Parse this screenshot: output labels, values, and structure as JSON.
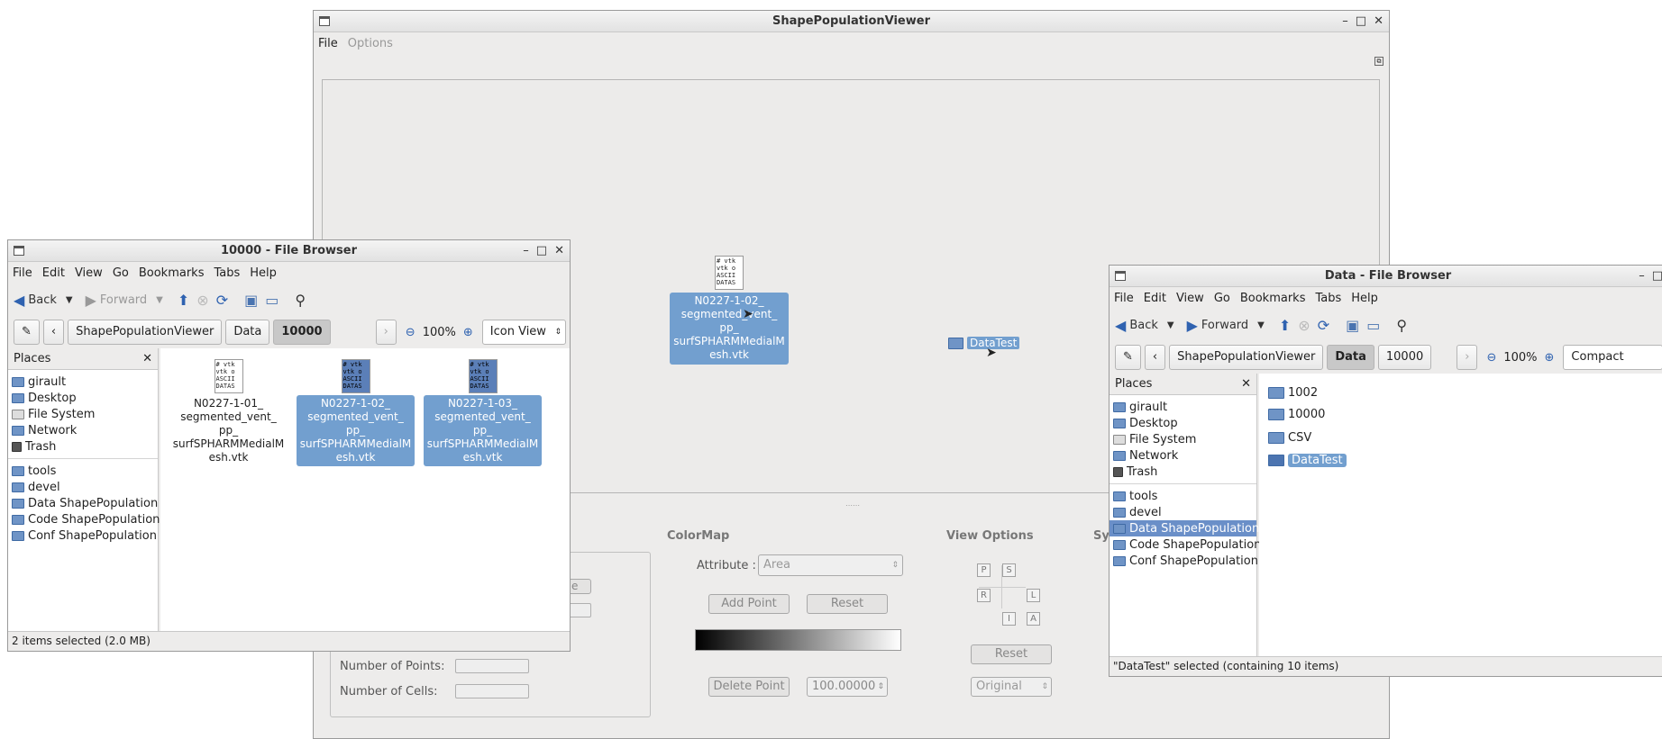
{
  "spv": {
    "title": "ShapePopulationViewer",
    "menu": [
      "File",
      "Options"
    ],
    "colormap_title": "ColorMap",
    "attribute_label": "Attribute :",
    "attribute_value": "Area",
    "add_point": "Add Point",
    "reset": "Reset",
    "delete_point": "Delete Point",
    "point_value": "100.00000",
    "view_options_title": "View Options",
    "view_letters": [
      "P",
      "S",
      "R",
      "L",
      "I",
      "A"
    ],
    "view_reset": "Reset",
    "view_select": "Original",
    "sy_fragment": "Sy",
    "num_points_label": "Number of Points:",
    "num_cells_label": "Number of Cells:",
    "none_fragment": "one"
  },
  "desktop": {
    "drag_file_icon_text": "# vtk\nvtk o\nASCII\nDATAS",
    "drag_file_label": "N0227-1-02_\nsegmented_vent_\npp_\nsurfSPHARMMedialM\nesh.vtk",
    "drag_folder_label": "DataTest"
  },
  "fb1": {
    "title": "10000 - File Browser",
    "menu": [
      "File",
      "Edit",
      "View",
      "Go",
      "Bookmarks",
      "Tabs",
      "Help"
    ],
    "back": "Back",
    "forward": "Forward",
    "path": [
      "ShapePopulationViewer",
      "Data",
      "10000"
    ],
    "zoom": "100%",
    "view_mode": "Icon View",
    "places_label": "Places",
    "places": [
      "girault",
      "Desktop",
      "File System",
      "Network",
      "Trash"
    ],
    "bookmarks": [
      "tools",
      "devel",
      "Data ShapePopulation",
      "Code ShapePopulation",
      "Conf ShapePopulation"
    ],
    "files": [
      {
        "icon_text": "# vtk\nvtk o\nASCII\nDATAS",
        "name": "N0227-1-01_\nsegmented_vent_\npp_\nsurfSPHARMMedialM\nesh.vtk",
        "selected": false
      },
      {
        "icon_text": "# vtk\nvtk o\nASCII\nDATAS",
        "name": "N0227-1-02_\nsegmented_vent_\npp_\nsurfSPHARMMedialM\nesh.vtk",
        "selected": true
      },
      {
        "icon_text": "# vtk\nvtk o\nASCII\nDATAS",
        "name": "N0227-1-03_\nsegmented_vent_\npp_\nsurfSPHARMMedialM\nesh.vtk",
        "selected": true
      }
    ],
    "status": "2 items selected (2.0 MB)"
  },
  "fb2": {
    "title": "Data - File Browser",
    "menu": [
      "File",
      "Edit",
      "View",
      "Go",
      "Bookmarks",
      "Tabs",
      "Help"
    ],
    "back": "Back",
    "forward": "Forward",
    "path": [
      "ShapePopulationViewer",
      "Data",
      "10000"
    ],
    "zoom": "100%",
    "view_mode": "Compact View",
    "places_label": "Places",
    "places": [
      "girault",
      "Desktop",
      "File System",
      "Network",
      "Trash"
    ],
    "bookmarks": [
      "tools",
      "devel",
      "Data ShapePopulation",
      "Code ShapePopulation",
      "Conf ShapePopulation"
    ],
    "selected_bookmark": "Data ShapePopulation",
    "folders": [
      "1002",
      "10000",
      "CSV",
      "DataTest"
    ],
    "selected_folder": "DataTest",
    "status": "\"DataTest\" selected (containing 10 items)"
  }
}
